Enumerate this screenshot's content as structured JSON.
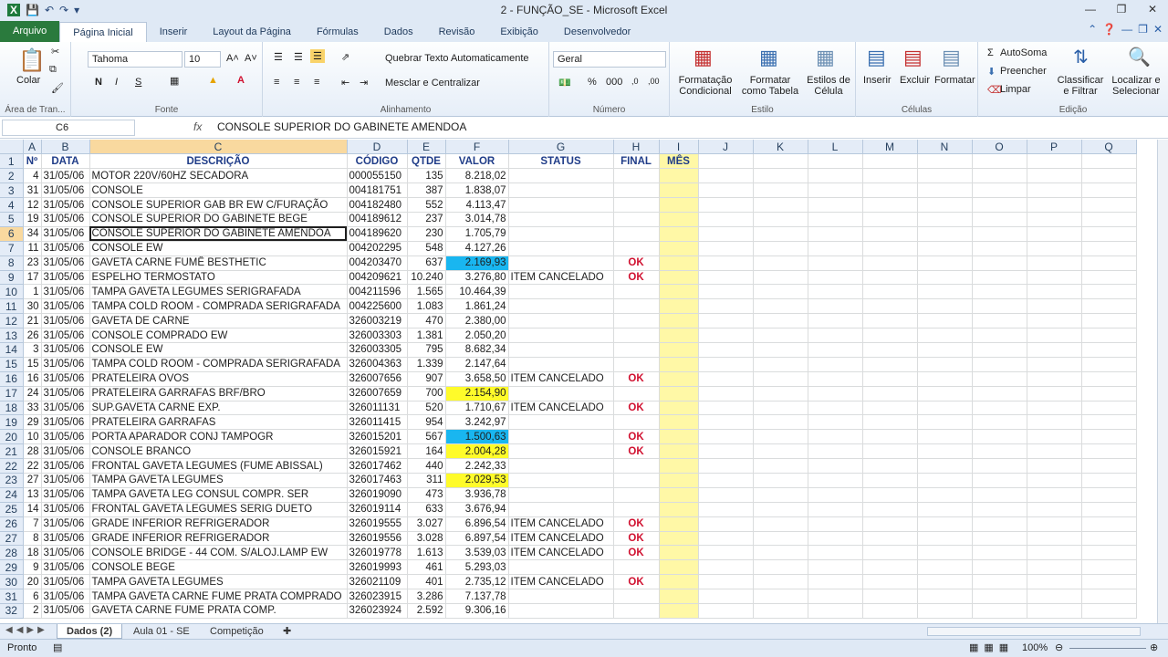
{
  "window": {
    "title": "2 - FUNÇÃO_SE - Microsoft Excel"
  },
  "tabs": [
    "Arquivo",
    "Página Inicial",
    "Inserir",
    "Layout da Página",
    "Fórmulas",
    "Dados",
    "Revisão",
    "Exibição",
    "Desenvolvedor"
  ],
  "ribbon": {
    "clipboard": {
      "paste": "Colar",
      "label": "Área de Tran..."
    },
    "font": {
      "name": "Tahoma",
      "size": "10",
      "bold": "N",
      "italic": "I",
      "underline": "S",
      "label": "Fonte"
    },
    "alignment": {
      "wrap": "Quebrar Texto Automaticamente",
      "merge": "Mesclar e Centralizar",
      "label": "Alinhamento"
    },
    "number": {
      "format": "Geral",
      "label": "Número"
    },
    "styles": {
      "conditional": "Formatação Condicional",
      "as_table": "Formatar como Tabela",
      "cell_styles": "Estilos de Célula",
      "label": "Estilo"
    },
    "cells": {
      "insert": "Inserir",
      "delete": "Excluir",
      "format": "Formatar",
      "label": "Células"
    },
    "editing": {
      "autosum": "AutoSoma",
      "fill": "Preencher",
      "clear": "Limpar",
      "sort": "Classificar e Filtrar",
      "find": "Localizar e Selecionar",
      "label": "Edição"
    }
  },
  "formula_bar": {
    "name_box": "C6",
    "fx": "fx",
    "value": "CONSOLE SUPERIOR DO GABINETE AMENDOA"
  },
  "grid": {
    "col_headers": [
      "A",
      "B",
      "C",
      "D",
      "E",
      "F",
      "G",
      "H",
      "I",
      "J",
      "K",
      "L",
      "M",
      "N",
      "O",
      "P",
      "Q"
    ],
    "headers": [
      "Nº",
      "DATA",
      "DESCRIÇÃO",
      "CÓDIGO",
      "QTDE",
      "VALOR",
      "STATUS",
      "FINAL",
      "MÊS"
    ],
    "rows": [
      [
        "4",
        "31/05/06",
        "MOTOR 220V/60HZ SECADORA",
        "000055150",
        "135",
        "8.218,02",
        "",
        ""
      ],
      [
        "31",
        "31/05/06",
        "CONSOLE",
        "004181751",
        "387",
        "1.838,07",
        "",
        ""
      ],
      [
        "12",
        "31/05/06",
        "CONSOLE SUPERIOR GAB BR EW C/FURAÇÃO",
        "004182480",
        "552",
        "4.113,47",
        "",
        ""
      ],
      [
        "19",
        "31/05/06",
        "CONSOLE SUPERIOR DO GABINETE BEGE",
        "004189612",
        "237",
        "3.014,78",
        "",
        ""
      ],
      [
        "34",
        "31/05/06",
        "CONSOLE SUPERIOR DO GABINETE AMENDOA",
        "004189620",
        "230",
        "1.705,79",
        "",
        ""
      ],
      [
        "11",
        "31/05/06",
        "CONSOLE EW",
        "004202295",
        "548",
        "4.127,26",
        "",
        ""
      ],
      [
        "23",
        "31/05/06",
        "GAVETA CARNE FUMÊ BESTHETIC",
        "004203470",
        "637",
        "2.169,93",
        "",
        "OK"
      ],
      [
        "17",
        "31/05/06",
        "ESPELHO TERMOSTATO",
        "004209621",
        "10.240",
        "3.276,80",
        "ITEM CANCELADO",
        "OK"
      ],
      [
        "1",
        "31/05/06",
        "TAMPA GAVETA LEGUMES SERIGRAFADA",
        "004211596",
        "1.565",
        "10.464,39",
        "",
        ""
      ],
      [
        "30",
        "31/05/06",
        "TAMPA COLD ROOM - COMPRADA SERIGRAFADA",
        "004225600",
        "1.083",
        "1.861,24",
        "",
        ""
      ],
      [
        "21",
        "31/05/06",
        "GAVETA DE CARNE",
        "326003219",
        "470",
        "2.380,00",
        "",
        ""
      ],
      [
        "26",
        "31/05/06",
        "CONSOLE COMPRADO EW",
        "326003303",
        "1.381",
        "2.050,20",
        "",
        ""
      ],
      [
        "3",
        "31/05/06",
        "CONSOLE EW",
        "326003305",
        "795",
        "8.682,34",
        "",
        ""
      ],
      [
        "15",
        "31/05/06",
        "TAMPA COLD ROOM  - COMPRADA SERIGRAFADA",
        "326004363",
        "1.339",
        "2.147,64",
        "",
        ""
      ],
      [
        "16",
        "31/05/06",
        "PRATELEIRA OVOS",
        "326007656",
        "907",
        "3.658,50",
        "ITEM CANCELADO",
        "OK"
      ],
      [
        "24",
        "31/05/06",
        "PRATELEIRA GARRAFAS BRF/BRO",
        "326007659",
        "700",
        "2.154,90",
        "",
        ""
      ],
      [
        "33",
        "31/05/06",
        "SUP.GAVETA CARNE EXP.",
        "326011131",
        "520",
        "1.710,67",
        "ITEM CANCELADO",
        "OK"
      ],
      [
        "29",
        "31/05/06",
        "PRATELEIRA GARRAFAS",
        "326011415",
        "954",
        "3.242,97",
        "",
        ""
      ],
      [
        "10",
        "31/05/06",
        "PORTA APARADOR CONJ TAMPOGR",
        "326015201",
        "567",
        "1.500,63",
        "",
        "OK"
      ],
      [
        "28",
        "31/05/06",
        "CONSOLE BRANCO",
        "326015921",
        "164",
        "2.004,28",
        "",
        "OK"
      ],
      [
        "22",
        "31/05/06",
        "FRONTAL GAVETA LEGUMES (FUME ABISSAL)",
        "326017462",
        "440",
        "2.242,33",
        "",
        ""
      ],
      [
        "27",
        "31/05/06",
        "TAMPA GAVETA LEGUMES",
        "326017463",
        "311",
        "2.029,53",
        "",
        ""
      ],
      [
        "13",
        "31/05/06",
        "TAMPA GAVETA LEG CONSUL COMPR. SER",
        "326019090",
        "473",
        "3.936,78",
        "",
        ""
      ],
      [
        "14",
        "31/05/06",
        "FRONTAL GAVETA LEGUMES SERIG DUETO",
        "326019114",
        "633",
        "3.676,94",
        "",
        ""
      ],
      [
        "7",
        "31/05/06",
        "GRADE INFERIOR REFRIGERADOR",
        "326019555",
        "3.027",
        "6.896,54",
        "ITEM CANCELADO",
        "OK"
      ],
      [
        "8",
        "31/05/06",
        "GRADE INFERIOR REFRIGERADOR",
        "326019556",
        "3.028",
        "6.897,54",
        "ITEM CANCELADO",
        "OK"
      ],
      [
        "18",
        "31/05/06",
        "CONSOLE  BRIDGE - 44 COM. S/ALOJ.LAMP EW",
        "326019778",
        "1.613",
        "3.539,03",
        "ITEM CANCELADO",
        "OK"
      ],
      [
        "9",
        "31/05/06",
        "CONSOLE  BEGE",
        "326019993",
        "461",
        "5.293,03",
        "",
        ""
      ],
      [
        "20",
        "31/05/06",
        "TAMPA GAVETA LEGUMES",
        "326021109",
        "401",
        "2.735,12",
        "ITEM CANCELADO",
        "OK"
      ],
      [
        "6",
        "31/05/06",
        "TAMPA GAVETA CARNE FUME PRATA COMPRADO",
        "326023915",
        "3.286",
        "7.137,78",
        "",
        ""
      ],
      [
        "2",
        "31/05/06",
        "GAVETA CARNE FUME PRATA COMP.",
        "326023924",
        "2.592",
        "9.306,16",
        "",
        ""
      ]
    ],
    "value_highlight": {
      "8": "cyan",
      "17": "yellow",
      "20": "cyan",
      "21": "yellow",
      "23": "yellow"
    }
  },
  "sheets": [
    "Dados (2)",
    "Aula 01 - SE",
    "Competição"
  ],
  "status": {
    "mode": "Pronto",
    "zoom": "100%"
  }
}
